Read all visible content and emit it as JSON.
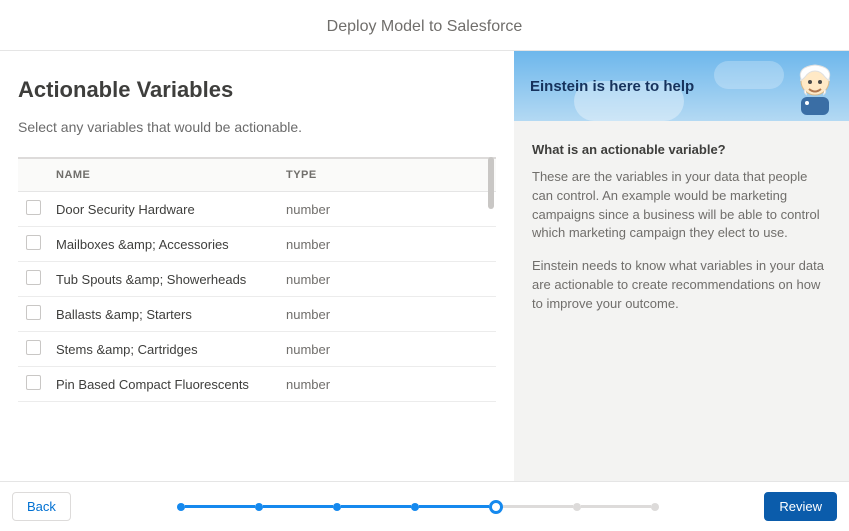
{
  "header": {
    "title": "Deploy Model to Salesforce"
  },
  "left": {
    "heading": "Actionable Variables",
    "subtitle": "Select any variables that would be actionable.",
    "columns": {
      "name": "NAME",
      "type": "TYPE"
    },
    "rows": [
      {
        "name": "Door Security Hardware",
        "type": "number"
      },
      {
        "name": "Mailboxes &amp; Accessories",
        "type": "number"
      },
      {
        "name": "Tub Spouts &amp; Showerheads",
        "type": "number"
      },
      {
        "name": "Ballasts &amp; Starters",
        "type": "number"
      },
      {
        "name": "Stems &amp; Cartridges",
        "type": "number"
      },
      {
        "name": "Pin Based Compact Fluorescents",
        "type": "number"
      }
    ]
  },
  "right": {
    "title": "Einstein is here to help",
    "question": "What is an actionable variable?",
    "para1": "These are the variables in your data that people can control. An example would be marketing campaigns since a business will be able to control which marketing campaign they elect to use.",
    "para2": "Einstein needs to know what variables in your data are actionable to create recommendations on how to improve your outcome."
  },
  "footer": {
    "back": "Back",
    "review": "Review",
    "steps": {
      "total": 7,
      "current": 5
    }
  }
}
